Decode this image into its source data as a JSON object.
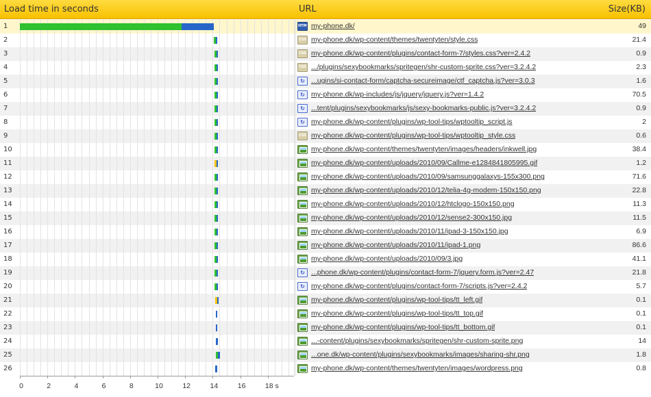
{
  "header": {
    "load_time": "Load time in seconds",
    "url": "URL",
    "size": "Size(KB)"
  },
  "colors": {
    "header": "#f8c000",
    "connect": "#2fc12f",
    "download": "#2766c8",
    "wait": "#f2c200"
  },
  "chart_data": {
    "type": "waterfall",
    "x_unit": "s",
    "xlim": [
      0,
      20
    ],
    "ticks": [
      "0",
      "2",
      "4",
      "6",
      "8",
      "10",
      "12",
      "14",
      "16",
      "18 s"
    ],
    "rows": [
      {
        "n": "1",
        "icon": "html",
        "url": "my-phone.dk/",
        "size": "49",
        "segs": [
          [
            0,
            11.75,
            "g"
          ],
          [
            11.75,
            14.1,
            "b"
          ]
        ]
      },
      {
        "n": "2",
        "icon": "css",
        "url": "my-phone.dk/wp-content/themes/twentyten/style.css",
        "size": "21.4",
        "segs": [
          [
            14.1,
            14.25,
            "g"
          ],
          [
            14.25,
            14.35,
            "b"
          ]
        ]
      },
      {
        "n": "3",
        "icon": "css",
        "url": "my-phone.dk/wp-content/plugins/contact-form-7/styles.css?ver=2.4.2",
        "size": "0.9",
        "segs": [
          [
            14.15,
            14.3,
            "g"
          ],
          [
            14.3,
            14.4,
            "b"
          ]
        ]
      },
      {
        "n": "4",
        "icon": "css",
        "url": ".../plugins/sexybookmarks/spritegen/shr-custom-sprite.css?ver=3.2.4.2",
        "size": "2.3",
        "segs": [
          [
            14.15,
            14.3,
            "g"
          ],
          [
            14.3,
            14.4,
            "b"
          ]
        ]
      },
      {
        "n": "5",
        "icon": "js",
        "url": "...ugins/si-contact-form/captcha-secureimage/ctf_captcha.js?ver=3.0.3",
        "size": "1.6",
        "segs": [
          [
            14.15,
            14.3,
            "g"
          ],
          [
            14.3,
            14.4,
            "b"
          ]
        ]
      },
      {
        "n": "6",
        "icon": "js",
        "url": "my-phone.dk/wp-includes/js/jquery/jquery.js?ver=1.4.2",
        "size": "70.5",
        "segs": [
          [
            14.15,
            14.3,
            "g"
          ],
          [
            14.3,
            14.4,
            "b"
          ]
        ]
      },
      {
        "n": "7",
        "icon": "js",
        "url": "...tent/plugins/sexybookmarks/js/sexy-bookmarks-public.js?ver=3.2.4.2",
        "size": "0.9",
        "segs": [
          [
            14.15,
            14.3,
            "g"
          ],
          [
            14.3,
            14.4,
            "b"
          ]
        ]
      },
      {
        "n": "8",
        "icon": "js",
        "url": "my-phone.dk/wp-content/plugins/wp-tool-tips/wptooltip_script.js",
        "size": "2",
        "segs": [
          [
            14.15,
            14.3,
            "g"
          ],
          [
            14.3,
            14.4,
            "b"
          ]
        ]
      },
      {
        "n": "9",
        "icon": "css",
        "url": "my-phone.dk/wp-content/plugins/wp-tool-tips/wptooltip_style.css",
        "size": "0.6",
        "segs": [
          [
            14.15,
            14.3,
            "g"
          ],
          [
            14.3,
            14.4,
            "b"
          ]
        ]
      },
      {
        "n": "10",
        "icon": "img",
        "url": "my-phone.dk/wp-content/themes/twentyten/images/headers/inkwell.jpg",
        "size": "38.4",
        "segs": [
          [
            14.15,
            14.3,
            "g"
          ],
          [
            14.3,
            14.4,
            "b"
          ]
        ]
      },
      {
        "n": "11",
        "icon": "img",
        "url": "my-phone.dk/wp-content/uploads/2010/09/Callme-e1284841805995.gif",
        "size": "1.2",
        "segs": [
          [
            14.15,
            14.3,
            "y"
          ],
          [
            14.3,
            14.4,
            "b"
          ]
        ]
      },
      {
        "n": "12",
        "icon": "img",
        "url": "my-phone.dk/wp-content/uploads/2010/09/samsunggalaxys-155x300.png",
        "size": "71.6",
        "segs": [
          [
            14.15,
            14.3,
            "g"
          ],
          [
            14.3,
            14.4,
            "b"
          ]
        ]
      },
      {
        "n": "13",
        "icon": "img",
        "url": "my-phone.dk/wp-content/uploads/2010/12/telia-4g-modem-150x150.png",
        "size": "22.8",
        "segs": [
          [
            14.15,
            14.3,
            "g"
          ],
          [
            14.3,
            14.4,
            "b"
          ]
        ]
      },
      {
        "n": "14",
        "icon": "img",
        "url": "my-phone.dk/wp-content/uploads/2010/12/htclogo-150x150.png",
        "size": "11.3",
        "segs": [
          [
            14.15,
            14.3,
            "g"
          ],
          [
            14.3,
            14.4,
            "b"
          ]
        ]
      },
      {
        "n": "15",
        "icon": "img",
        "url": "my-phone.dk/wp-content/uploads/2010/12/sense2-300x150.jpg",
        "size": "11.5",
        "segs": [
          [
            14.15,
            14.3,
            "g"
          ],
          [
            14.3,
            14.4,
            "b"
          ]
        ]
      },
      {
        "n": "16",
        "icon": "img",
        "url": "my-phone.dk/wp-content/uploads/2010/11/ipad-3-150x150.jpg",
        "size": "6.9",
        "segs": [
          [
            14.15,
            14.3,
            "g"
          ],
          [
            14.3,
            14.4,
            "b"
          ]
        ]
      },
      {
        "n": "17",
        "icon": "img",
        "url": "my-phone.dk/wp-content/uploads/2010/11/ipad-1.png",
        "size": "86.6",
        "segs": [
          [
            14.15,
            14.3,
            "g"
          ],
          [
            14.3,
            14.4,
            "b"
          ]
        ]
      },
      {
        "n": "18",
        "icon": "img",
        "url": "my-phone.dk/wp-content/uploads/2010/09/3.jpg",
        "size": "41.1",
        "segs": [
          [
            14.15,
            14.3,
            "g"
          ],
          [
            14.3,
            14.4,
            "b"
          ]
        ]
      },
      {
        "n": "19",
        "icon": "js",
        "url": "...phone.dk/wp-content/plugins/contact-form-7/jquery.form.js?ver=2.47",
        "size": "21.8",
        "segs": [
          [
            14.15,
            14.3,
            "g"
          ],
          [
            14.3,
            14.4,
            "b"
          ]
        ]
      },
      {
        "n": "20",
        "icon": "js",
        "url": "my-phone.dk/wp-content/plugins/contact-form-7/scripts.js?ver=2.4.2",
        "size": "5.7",
        "segs": [
          [
            14.15,
            14.3,
            "g"
          ],
          [
            14.3,
            14.4,
            "b"
          ]
        ]
      },
      {
        "n": "21",
        "icon": "img",
        "url": "my-phone.dk/wp-content/plugins/wp-tool-tips/tt_left.gif",
        "size": "0.1",
        "segs": [
          [
            14.2,
            14.35,
            "y"
          ],
          [
            14.35,
            14.45,
            "b"
          ]
        ]
      },
      {
        "n": "22",
        "icon": "img",
        "url": "my-phone.dk/wp-content/plugins/wp-tool-tips/tt_top.gif",
        "size": "0.1",
        "segs": [
          [
            14.25,
            14.35,
            "b"
          ]
        ]
      },
      {
        "n": "23",
        "icon": "img",
        "url": "my-phone.dk/wp-content/plugins/wp-tool-tips/tt_bottom.gif",
        "size": "0.1",
        "segs": [
          [
            14.25,
            14.35,
            "b"
          ]
        ]
      },
      {
        "n": "24",
        "icon": "img",
        "url": "...-content/plugins/sexybookmarks/spritegen/shr-custom-sprite.png",
        "size": "14",
        "segs": [
          [
            14.25,
            14.4,
            "b"
          ]
        ]
      },
      {
        "n": "25",
        "icon": "img",
        "url": "...one.dk/wp-content/plugins/sexybookmarks/images/sharing-shr.png",
        "size": "1.8",
        "segs": [
          [
            14.25,
            14.4,
            "g"
          ],
          [
            14.4,
            14.55,
            "b"
          ]
        ]
      },
      {
        "n": "26",
        "icon": "img",
        "url": "my-phone.dk/wp-content/themes/twentyten/images/wordpress.png",
        "size": "0.8",
        "segs": [
          [
            14.2,
            14.35,
            "b"
          ]
        ]
      }
    ]
  }
}
